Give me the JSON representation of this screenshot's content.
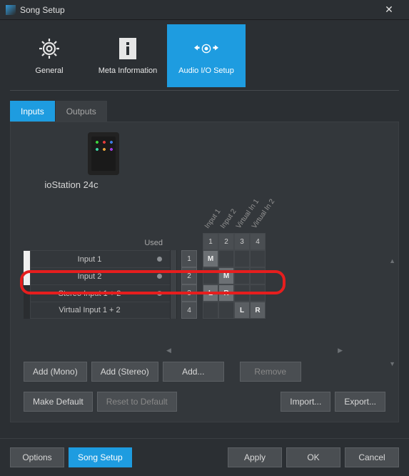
{
  "window": {
    "title": "Song Setup",
    "close_glyph": "✕"
  },
  "top_tabs": [
    {
      "label": "General",
      "icon": "gear-icon",
      "active": false
    },
    {
      "label": "Meta Information",
      "icon": "info-icon",
      "active": false
    },
    {
      "label": "Audio I/O Setup",
      "icon": "io-icon",
      "active": true
    }
  ],
  "sub_tabs": {
    "inputs": "Inputs",
    "outputs": "Outputs",
    "active": "inputs"
  },
  "device": {
    "name": "ioStation 24c"
  },
  "matrix": {
    "used_header": "Used",
    "column_labels": [
      "Input 1",
      "Input 2",
      "Virtual In 1",
      "Virtual In 2"
    ],
    "column_numbers": [
      "1",
      "2",
      "3",
      "4"
    ],
    "rows": [
      {
        "label": "Input 1",
        "used": true,
        "idx": "1",
        "cells": [
          "M",
          "",
          "",
          ""
        ],
        "chip": "light"
      },
      {
        "label": "Input 2",
        "used": true,
        "idx": "2",
        "cells": [
          "",
          "M",
          "",
          ""
        ],
        "chip": "light"
      },
      {
        "label": "Stereo Input 1 + 2",
        "used": true,
        "idx": "3",
        "cells": [
          "L",
          "R",
          "",
          ""
        ],
        "chip": "dark"
      },
      {
        "label": "Virtual Input 1 + 2",
        "used": false,
        "idx": "4",
        "cells": [
          "",
          "",
          "L",
          "R"
        ],
        "chip": "dark",
        "highlighted": true
      }
    ]
  },
  "panel_buttons": {
    "add_mono": "Add (Mono)",
    "add_stereo": "Add (Stereo)",
    "add": "Add...",
    "remove": "Remove",
    "make_default": "Make Default",
    "reset_default": "Reset to Default",
    "import": "Import...",
    "export": "Export..."
  },
  "footer": {
    "options": "Options",
    "song_setup": "Song Setup",
    "apply": "Apply",
    "ok": "OK",
    "cancel": "Cancel"
  }
}
